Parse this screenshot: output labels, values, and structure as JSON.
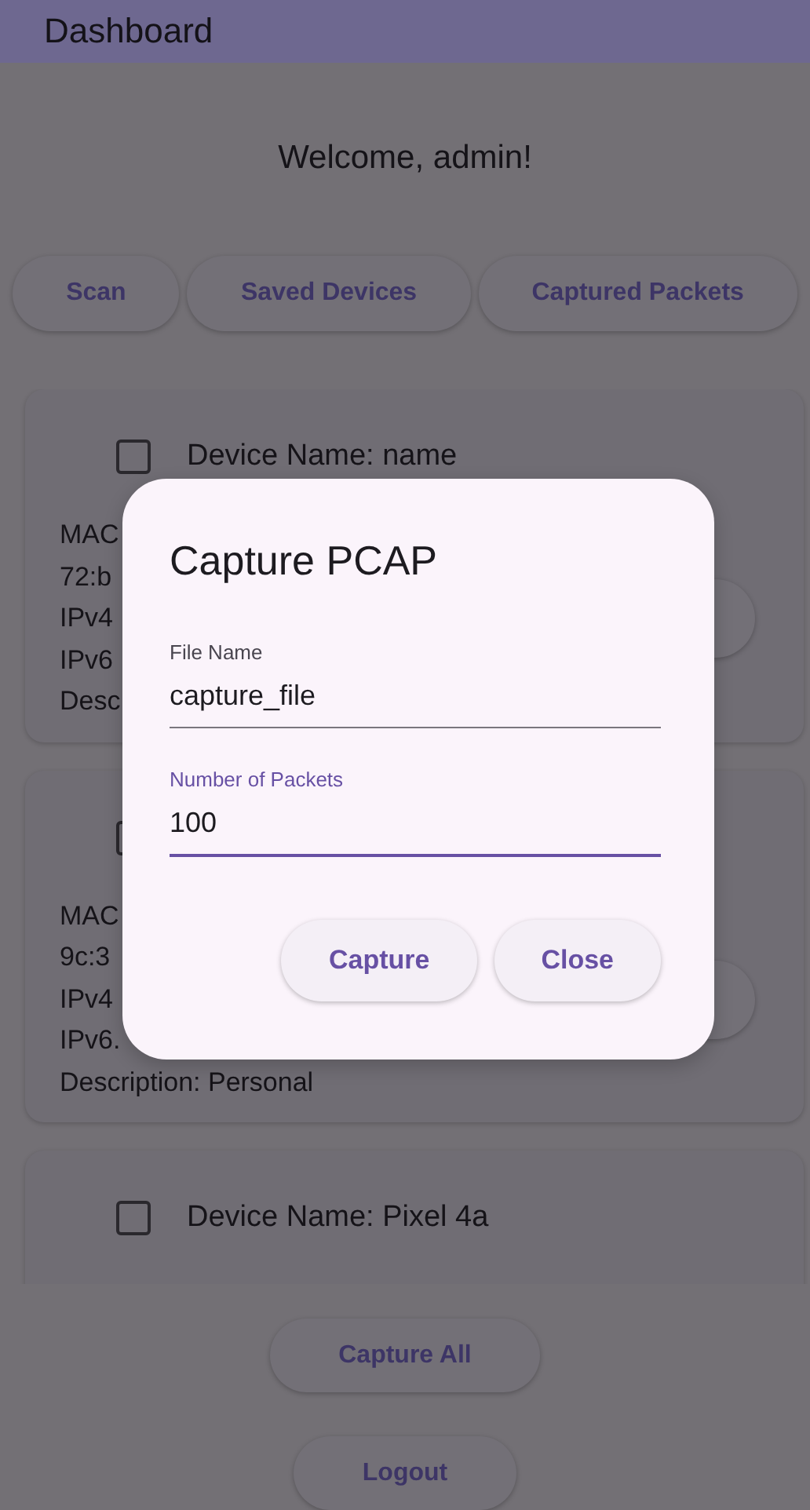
{
  "app_bar": {
    "title": "Dashboard"
  },
  "welcome": "Welcome, admin!",
  "nav_buttons": [
    "Scan",
    "Saved Devices",
    "Captured Packets"
  ],
  "devices": [
    {
      "name_label": "Device Name: name",
      "checked": false,
      "lines": [
        "MAC",
        "72:b",
        "IPv4",
        "IPv6",
        "Desc"
      ],
      "has_action_button": true
    },
    {
      "checked": false,
      "lines": [
        "MAC",
        "9c:3",
        "IPv4",
        "IPv6.",
        "Description: Personal"
      ],
      "has_action_button": true
    },
    {
      "name_label": "Device Name: Pixel 4a",
      "checked": false,
      "has_action_button": false
    }
  ],
  "bottom_buttons": [
    "Capture All",
    "Logout"
  ],
  "dialog": {
    "title": "Capture PCAP",
    "fields": [
      {
        "label": "File Name",
        "value": "capture_file",
        "focused": false
      },
      {
        "label": "Number of Packets",
        "value": "100",
        "focused": true
      }
    ],
    "actions": [
      "Capture",
      "Close"
    ]
  }
}
